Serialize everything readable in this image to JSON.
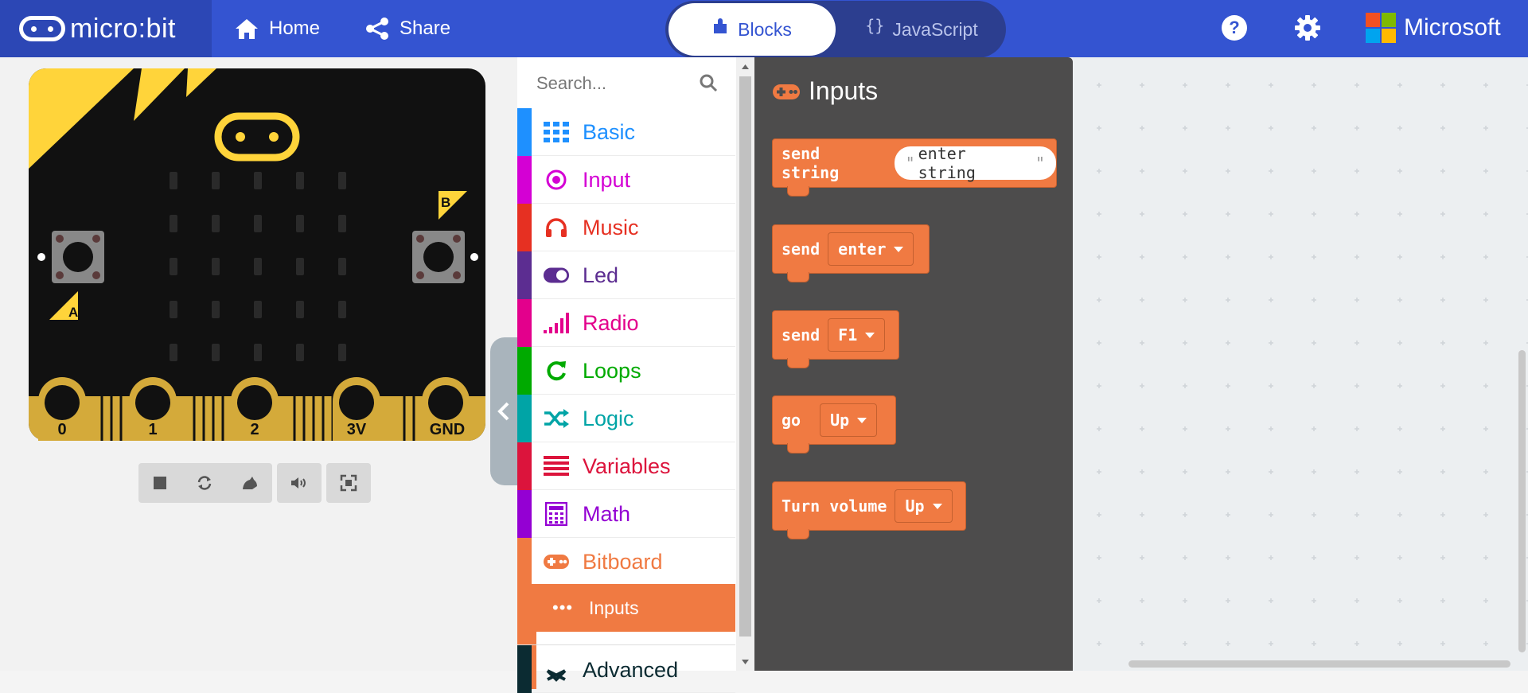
{
  "topbar": {
    "logo_text": "micro:bit",
    "home_label": "Home",
    "share_label": "Share",
    "tab_blocks_label": "Blocks",
    "tab_js_braces": "{}",
    "tab_js_label": "JavaScript",
    "microsoft_label": "Microsoft",
    "colors": {
      "bar": "#3454d1",
      "logo_bg": "#2c47b5"
    }
  },
  "simulator": {
    "button_a_label": "A",
    "button_b_label": "B",
    "pins": [
      "0",
      "1",
      "2",
      "3V",
      "GND"
    ],
    "controls": [
      "stop-icon",
      "restart-icon",
      "debug-icon",
      "mute-icon",
      "fullscreen-icon"
    ]
  },
  "toolbox": {
    "search_placeholder": "Search...",
    "categories": [
      {
        "label": "Basic",
        "color": "#1e90ff",
        "icon": "grid-icon"
      },
      {
        "label": "Input",
        "color": "#d400d4",
        "icon": "target-icon"
      },
      {
        "label": "Music",
        "color": "#e63022",
        "icon": "headphones-icon"
      },
      {
        "label": "Led",
        "color": "#5c2d91",
        "icon": "toggle-icon"
      },
      {
        "label": "Radio",
        "color": "#e3008c",
        "icon": "signal-icon"
      },
      {
        "label": "Loops",
        "color": "#00aa00",
        "icon": "refresh-icon"
      },
      {
        "label": "Logic",
        "color": "#00a4a6",
        "icon": "shuffle-icon"
      },
      {
        "label": "Variables",
        "color": "#dc143c",
        "icon": "lines-icon"
      },
      {
        "label": "Math",
        "color": "#9400d3",
        "icon": "calculator-icon"
      },
      {
        "label": "Bitboard",
        "color": "#f07a42",
        "icon": "gamepad-icon"
      }
    ],
    "subcategory": {
      "label": "Inputs",
      "dots": "•••"
    },
    "advanced_label": "Advanced"
  },
  "flyout": {
    "title": "Inputs",
    "blocks": {
      "send_string": {
        "label": "send string",
        "value": "enter string"
      },
      "send_key": {
        "label": "send",
        "value": "enter"
      },
      "send_fkey": {
        "label": "send",
        "value": "F1"
      },
      "go": {
        "label": "go",
        "value": "Up"
      },
      "turn_volume": {
        "label": "Turn volume",
        "value": "Up"
      }
    },
    "colors": {
      "block": "#f07a42",
      "background": "#4d4c4c"
    }
  }
}
